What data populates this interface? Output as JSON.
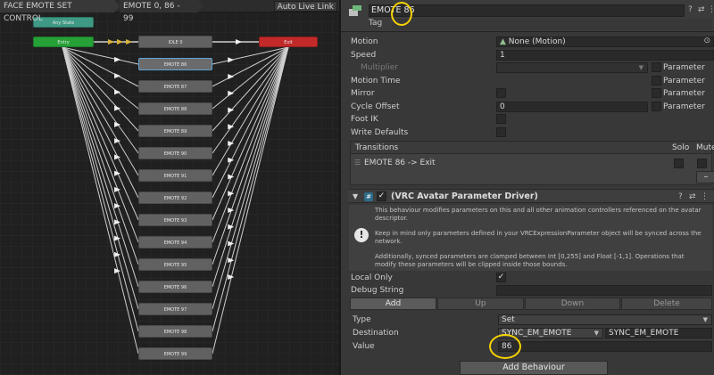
{
  "graph": {
    "breadcrumb_1": "FACE EMOTE SET CONTROL",
    "breadcrumb_2": "EMOTE 0, 86 - 99",
    "auto_live_link": "Auto Live Link",
    "any_state": "Any State",
    "entry": "Entry",
    "exit": "Exit",
    "states": [
      "IDLE 0",
      "EMOTE 86",
      "EMOTE 87",
      "EMOTE 88",
      "EMOTE 89",
      "EMOTE 90",
      "EMOTE 91",
      "EMOTE 92",
      "EMOTE 93",
      "EMOTE 94",
      "EMOTE 95",
      "EMOTE 96",
      "EMOTE 97",
      "EMOTE 98",
      "EMOTE 99"
    ]
  },
  "inspector": {
    "state_name": "EMOTE 86",
    "tag_label": "Tag",
    "motion_label": "Motion",
    "motion_value": "None (Motion)",
    "speed_label": "Speed",
    "speed_value": "1",
    "multiplier_label": "Multiplier",
    "parameter_label": "Parameter",
    "motion_time_label": "Motion Time",
    "mirror_label": "Mirror",
    "cycle_offset_label": "Cycle Offset",
    "cycle_offset_value": "0",
    "foot_ik_label": "Foot IK",
    "write_defaults_label": "Write Defaults",
    "transitions_label": "Transitions",
    "solo_label": "Solo",
    "mute_label": "Mute",
    "transition_item": "EMOTE 86 -> Exit",
    "minus_label": "–"
  },
  "behaviour": {
    "title": "(VRC Avatar Parameter Driver)",
    "help_1": "This behaviour modifies parameters on this and all other animation controllers referenced on the avatar descriptor.",
    "help_2": "Keep in mind only parameters defined in your VRCExpressionParameter object will be synced across the network.",
    "help_3": "Additionally, synced parameters are clamped between Int [0,255] and Float [-1,1]. Operations that modify these parameters will be clipped inside those bounds.",
    "local_only_label": "Local Only",
    "debug_string_label": "Debug String",
    "add_label": "Add",
    "up_label": "Up",
    "down_label": "Down",
    "delete_label": "Delete",
    "type_label": "Type",
    "type_value": "Set",
    "destination_label": "Destination",
    "destination_value": "SYNC_EM_EMOTE",
    "destination_text": "SYNC_EM_EMOTE",
    "value_label": "Value",
    "value_value": "86",
    "add_behaviour": "Add Behaviour"
  },
  "colors": {
    "any_state": "#3e9a84",
    "entry": "#26a137",
    "exit": "#c22a2a",
    "state": "#616161",
    "highlight": "#f5d200"
  }
}
